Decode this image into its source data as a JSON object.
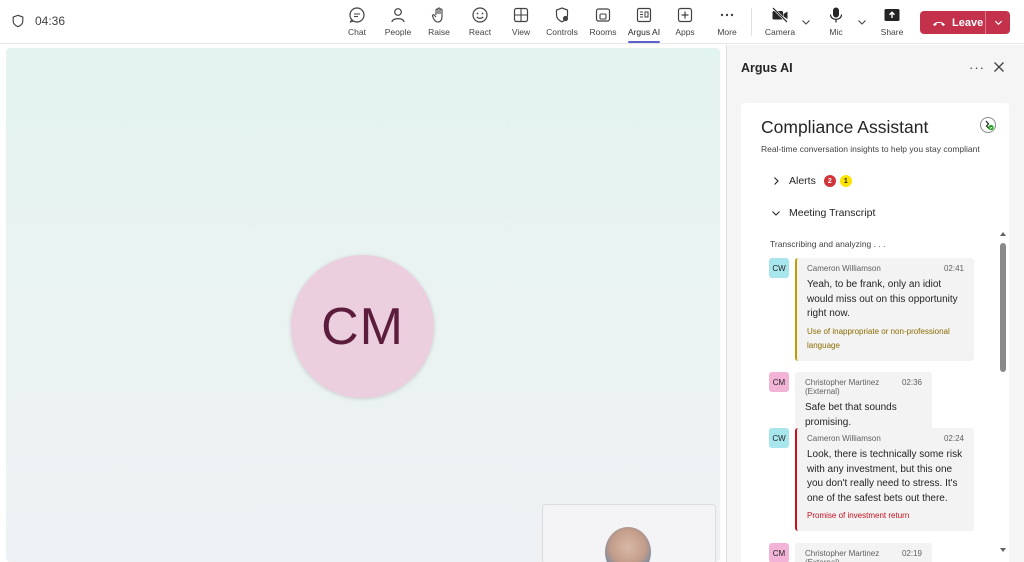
{
  "call": {
    "timer": "04:36"
  },
  "toolbar": {
    "items": [
      {
        "label": "Chat",
        "icon": "chat-icon"
      },
      {
        "label": "People",
        "icon": "people-icon"
      },
      {
        "label": "Raise",
        "icon": "raise-hand-icon"
      },
      {
        "label": "React",
        "icon": "react-icon"
      },
      {
        "label": "View",
        "icon": "view-icon"
      },
      {
        "label": "Controls",
        "icon": "controls-icon"
      },
      {
        "label": "Rooms",
        "icon": "rooms-icon"
      },
      {
        "label": "Argus AI",
        "icon": "argus-ai-icon"
      },
      {
        "label": "Apps",
        "icon": "apps-icon"
      },
      {
        "label": "More",
        "icon": "more-icon"
      }
    ],
    "camera_label": "Camera",
    "mic_label": "Mic",
    "share_label": "Share",
    "leave_label": "Leave",
    "active": "Argus AI",
    "leave_color": "#c4314b",
    "accent_color": "#5b5fc7"
  },
  "stage": {
    "participant_initials": "CM"
  },
  "panel": {
    "title": "Argus AI",
    "card_title": "Compliance Assistant",
    "card_subtitle": "Real-time conversation insights to help you stay compliant",
    "alerts_label": "Alerts",
    "alerts_red_count": "2",
    "alerts_yellow_count": "1",
    "transcript_label": "Meeting Transcript",
    "status": "Transcribing and analyzing . . .",
    "messages": [
      {
        "initials": "CW",
        "speaker": "Cameron Williamson",
        "time": "02:41",
        "text": "Yeah, to be frank, only an idiot would miss out on this opportunity right now.",
        "flag": "Use of inappropriate or non-professional language",
        "flag_color": "#c19c00"
      },
      {
        "initials": "CM",
        "speaker": "Christopher Martinez (External)",
        "time": "02:36",
        "text": "Safe bet that sounds promising."
      },
      {
        "initials": "CW",
        "speaker": "Cameron Williamson",
        "time": "02:24",
        "text": "Look, there is technically some risk with any investment, but this one you don't really need to stress. It's one of the safest bets out there.",
        "flag": "Promise of investment return",
        "flag_color": "#c50f1f"
      },
      {
        "initials": "CM",
        "speaker": "Christopher Martinez (External)",
        "time": "02:19",
        "text": ""
      }
    ]
  }
}
